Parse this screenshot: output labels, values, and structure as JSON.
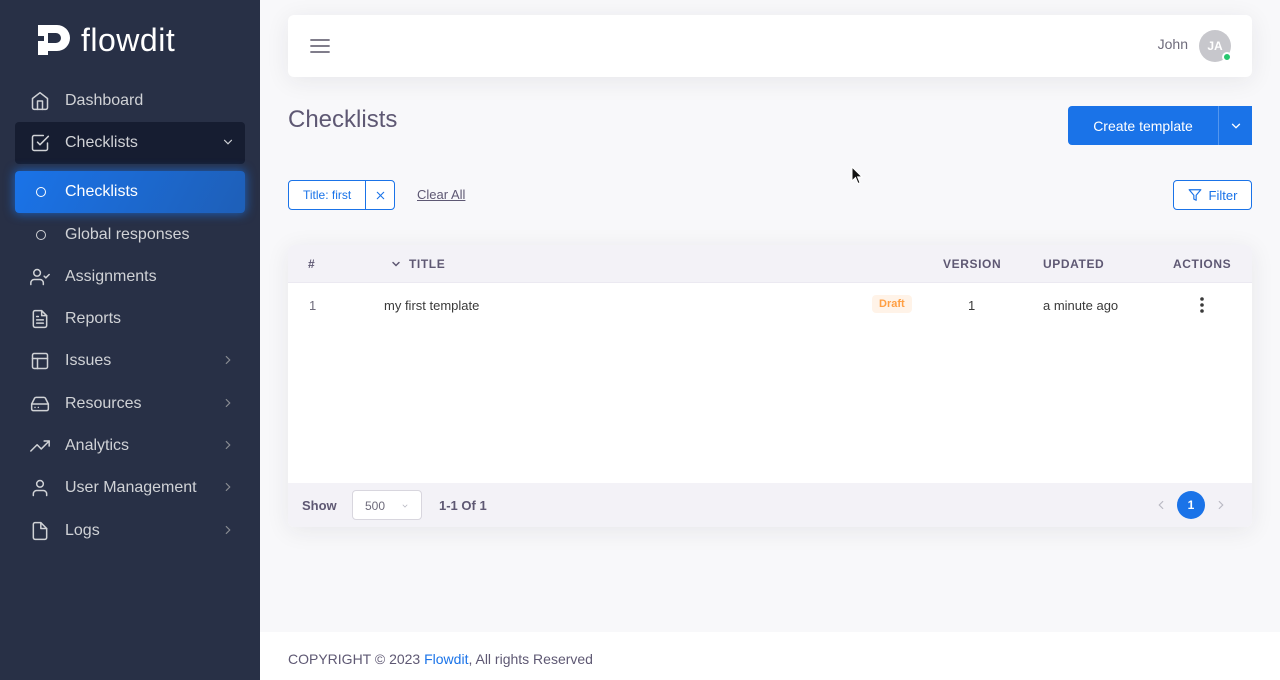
{
  "brand": {
    "name": "flowdit"
  },
  "sidebar": {
    "items": [
      {
        "label": "Dashboard",
        "icon": "home-icon",
        "chevron": false
      },
      {
        "label": "Checklists",
        "icon": "checkbox-icon",
        "chevron": true,
        "state": "open"
      },
      {
        "label": "Checklists",
        "icon": "circle-icon",
        "sub": true,
        "state": "active"
      },
      {
        "label": "Global responses",
        "icon": "circle-icon",
        "sub": true
      },
      {
        "label": "Assignments",
        "icon": "user-check-icon",
        "chevron": false
      },
      {
        "label": "Reports",
        "icon": "file-text-icon",
        "chevron": false
      },
      {
        "label": "Issues",
        "icon": "layout-icon",
        "chevron": true
      },
      {
        "label": "Resources",
        "icon": "hard-drive-icon",
        "chevron": true
      },
      {
        "label": "Analytics",
        "icon": "trending-up-icon",
        "chevron": true
      },
      {
        "label": "User Management",
        "icon": "user-icon",
        "chevron": true
      },
      {
        "label": "Logs",
        "icon": "file-icon",
        "chevron": true
      }
    ]
  },
  "header": {
    "user_name": "John",
    "avatar_initials": "JA",
    "status_color": "#28c76f"
  },
  "page": {
    "title": "Checklists",
    "create_label": "Create template"
  },
  "filters": {
    "chip_label": "Title: first",
    "clear_all": "Clear All",
    "filter_label": "Filter"
  },
  "table": {
    "columns": {
      "num": "#",
      "title": "TITLE",
      "version": "VERSION",
      "updated": "UPDATED",
      "actions": "ACTIONS"
    },
    "rows": [
      {
        "num": "1",
        "title": "my first template",
        "badge": "Draft",
        "version": "1",
        "updated": "a minute ago"
      }
    ]
  },
  "pagination": {
    "show_label": "Show",
    "page_size": "500",
    "range": "1-1 Of 1",
    "current_page": "1"
  },
  "footer": {
    "prefix": "COPYRIGHT © 2023 ",
    "link": "Flowdit",
    "suffix": ", All rights Reserved"
  },
  "colors": {
    "accent": "#1a73e8",
    "sidebar_bg": "#283046",
    "draft_badge": "#ff9f43"
  }
}
